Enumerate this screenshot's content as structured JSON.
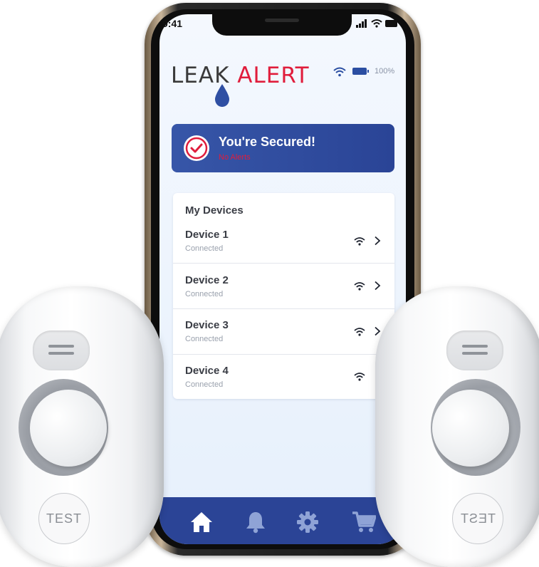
{
  "status_bar": {
    "time": "9:41"
  },
  "app": {
    "logo": {
      "leak": "LEAK",
      "alert": "ALERT"
    },
    "header": {
      "battery_percent": "100%"
    },
    "secured_card": {
      "title": "You're Secured!",
      "subtitle": "No Alerts"
    },
    "devices": {
      "title": "My Devices",
      "items": [
        {
          "name": "Device 1",
          "status": "Connected"
        },
        {
          "name": "Device 2",
          "status": "Connected"
        },
        {
          "name": "Device 3",
          "status": "Connected"
        },
        {
          "name": "Device 4",
          "status": "Connected"
        }
      ]
    },
    "bottom_nav": [
      {
        "icon": "home-icon",
        "active": true
      },
      {
        "icon": "bell-icon",
        "active": false
      },
      {
        "icon": "gear-icon",
        "active": false
      },
      {
        "icon": "cart-icon",
        "active": false
      }
    ]
  },
  "sensors": {
    "test_label": "TEST"
  },
  "colors": {
    "brand_blue": "#2b4496",
    "alert_red": "#e01d3c",
    "screen_bg": "#eef4fc"
  }
}
